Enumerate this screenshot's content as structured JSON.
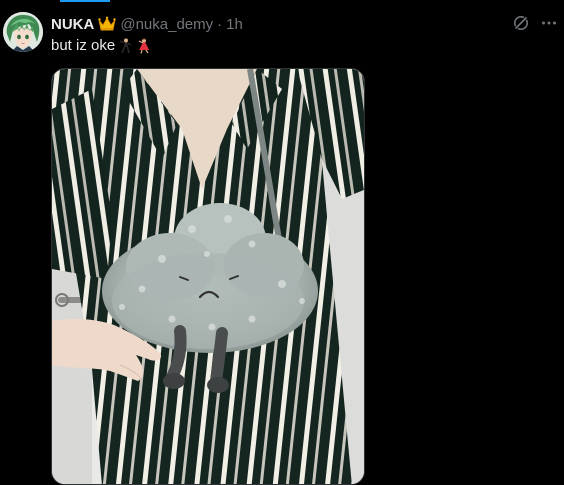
{
  "author": {
    "display_name": "NUKA",
    "handle": "@nuka_demy",
    "separator": "·",
    "time": "1h",
    "badge_icon": "crown-icon",
    "avatar": "avatar-anime-green-hair"
  },
  "tweet": {
    "text": "but iz oke",
    "emojis": [
      "man-dancing-emoji",
      "woman-dancing-emoji"
    ]
  },
  "actions": {
    "grok_icon": "grok-icon",
    "more_icon": "more-icon"
  },
  "media": {
    "description_icon": "photo-plush-cloud-bag",
    "alt": ""
  },
  "colors": {
    "background": "#000000",
    "text_primary": "#e7e9ea",
    "text_secondary": "#71767b",
    "accent": "#1d9bf0"
  }
}
